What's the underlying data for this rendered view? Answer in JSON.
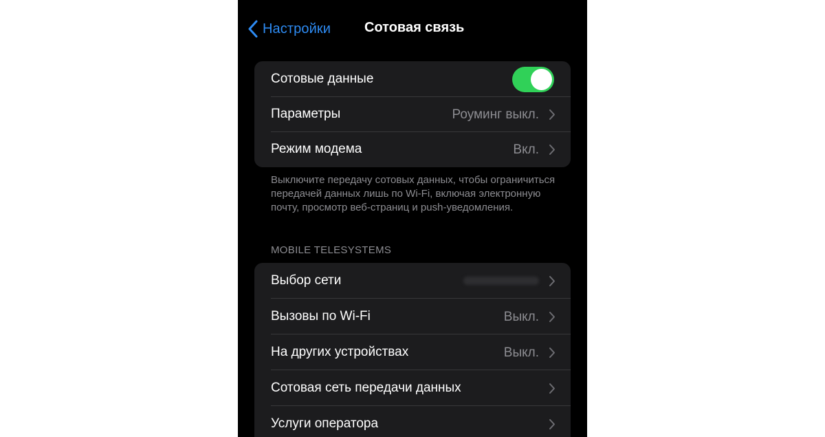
{
  "navbar": {
    "back_label": "Настройки",
    "title": "Сотовая связь",
    "back_icon": "chevron-left-icon"
  },
  "colors": {
    "accent": "#2e8cf4",
    "toggle_on": "#30d158",
    "background": "#000000",
    "cell": "#1c1c1e",
    "secondary_text": "#8d8d92"
  },
  "group1": {
    "cellular_data": {
      "label": "Сотовые данные",
      "toggle_on": true
    },
    "options": {
      "label": "Параметры",
      "value": "Роуминг выкл."
    },
    "hotspot": {
      "label": "Режим модема",
      "value": "Вкл."
    }
  },
  "footnote": "Выключите передачу сотовых данных, чтобы ограничиться передачей данных лишь по Wi-Fi, включая электронную почту, просмотр веб-страниц и push-уведомления.",
  "section_header": "MOBILE TELESYSTEMS",
  "group2": {
    "network_selection": {
      "label": "Выбор сети"
    },
    "wifi_calling": {
      "label": "Вызовы по Wi-Fi",
      "value": "Выкл."
    },
    "other_devices": {
      "label": "На других устройствах",
      "value": "Выкл."
    },
    "cellular_network": {
      "label": "Сотовая сеть передачи данных"
    },
    "carrier_services": {
      "label": "Услуги оператора"
    }
  }
}
